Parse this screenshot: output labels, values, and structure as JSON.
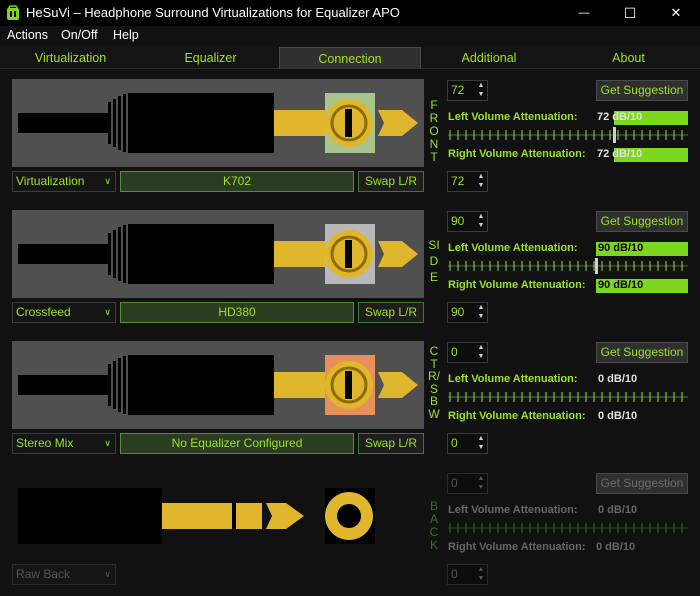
{
  "window": {
    "title": "HeSuVi – Headphone Surround Virtualizations for Equalizer APO",
    "controls": {
      "minimize": "—",
      "maximize": "☐",
      "close": "✕"
    }
  },
  "menu": [
    "Actions",
    "On/Off",
    "Help"
  ],
  "tabs": [
    {
      "label": "Virtualization",
      "active": false
    },
    {
      "label": "Equalizer",
      "active": false
    },
    {
      "label": "Connection",
      "active": true
    },
    {
      "label": "Additional",
      "active": false
    },
    {
      "label": "About",
      "active": false
    }
  ],
  "colors": {
    "accent": "#9ee02a",
    "bar_fill": "#7cd81e",
    "connector_gold": "#e0b62c"
  },
  "channels": [
    {
      "key": "front",
      "vertical_label": "FRONT",
      "source_select": "Virtualization",
      "headphone": "K702",
      "swap_label": "Swap L/R",
      "jack_color": "#a9c48c",
      "top_value": "72",
      "bottom_value": "72",
      "suggestion_label": "Get Suggestion",
      "left_label": "Left Volume Attenuation:",
      "left_value": "72 dB/10",
      "right_label": "Right Volume Attenuation:",
      "right_value": "72 dB/10",
      "level_fraction": 0.3,
      "disabled": false
    },
    {
      "key": "side",
      "vertical_label": "SIDE",
      "source_select": "Crossfeed",
      "headphone": "HD380",
      "swap_label": "Swap L/R",
      "jack_color": "#b8b8b8",
      "top_value": "90",
      "bottom_value": "90",
      "suggestion_label": "Get Suggestion",
      "left_label": "Left Volume Attenuation:",
      "left_value": "90 dB/10",
      "right_label": "Right Volume Attenuation:",
      "right_value": "90 dB/10",
      "level_fraction": 0.62,
      "disabled": false
    },
    {
      "key": "ctr",
      "vertical_label": "CTR/SBW",
      "source_select": "Stereo Mix",
      "headphone": "No Equalizer Configured",
      "swap_label": "Swap L/R",
      "jack_color": "#e8905a",
      "top_value": "0",
      "bottom_value": "0",
      "suggestion_label": "Get Suggestion",
      "left_label": "Left Volume Attenuation:",
      "left_value": "0 dB/10",
      "right_label": "Right Volume Attenuation:",
      "right_value": "0 dB/10",
      "level_fraction": 0,
      "disabled": false
    },
    {
      "key": "back",
      "vertical_label": "BACK",
      "source_select": "Raw Back",
      "top_value": "0",
      "bottom_value": "0",
      "suggestion_label": "Get Suggestion",
      "left_label": "Left Volume Attenuation:",
      "left_value": "0 dB/10",
      "right_label": "Right Volume Attenuation:",
      "right_value": "0 dB/10",
      "level_fraction": 0,
      "disabled": true
    }
  ]
}
